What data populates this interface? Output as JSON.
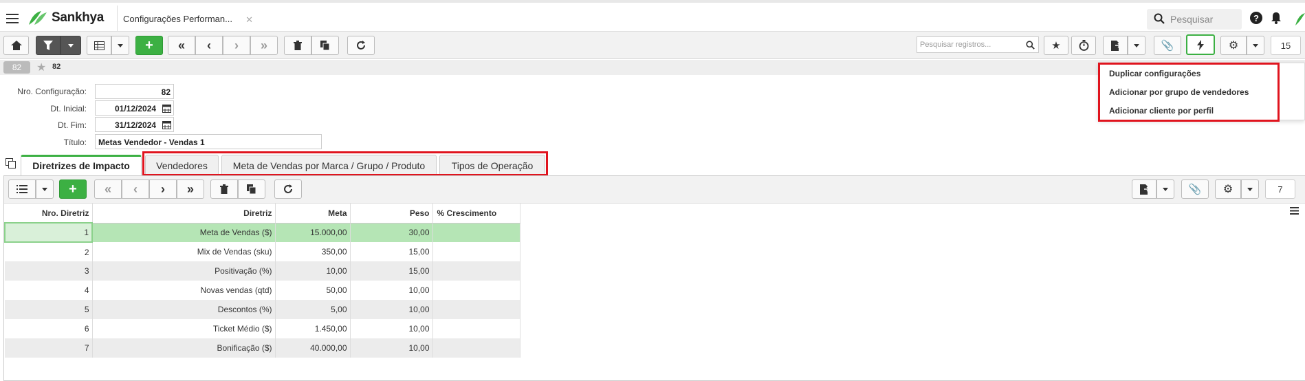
{
  "header": {
    "brand": "Sankhya",
    "page_tab": "Configurações Performan...",
    "search_placeholder": "Pesquisar"
  },
  "toolbar": {
    "search_records_placeholder": "Pesquisar registros...",
    "page_size": "15"
  },
  "record": {
    "badge": "82",
    "id": "82"
  },
  "form": {
    "fields": [
      {
        "label": "Nro. Configuração:",
        "value": "82"
      },
      {
        "label": "Dt. Inicial:",
        "value": "01/12/2024"
      },
      {
        "label": "Dt. Fim:",
        "value": "31/12/2024"
      },
      {
        "label": "Título:",
        "value": "Metas Vendedor - Vendas 1"
      }
    ]
  },
  "actions_menu": {
    "items": [
      "Duplicar configurações",
      "Adicionar por grupo de vendedores",
      "Adicionar cliente por perfil"
    ]
  },
  "tabs": [
    "Diretrizes de Impacto",
    "Vendedores",
    "Meta de Vendas por Marca / Grupo / Produto",
    "Tipos de Operação"
  ],
  "detail": {
    "page_size": "7",
    "columns": [
      "Nro. Diretriz",
      "Diretriz",
      "Meta",
      "Peso",
      "% Crescimento"
    ],
    "rows": [
      [
        "1",
        "Meta de Vendas ($)",
        "15.000,00",
        "30,00",
        ""
      ],
      [
        "2",
        "Mix de Vendas (sku)",
        "350,00",
        "15,00",
        ""
      ],
      [
        "3",
        "Positivação (%)",
        "10,00",
        "15,00",
        ""
      ],
      [
        "4",
        "Novas vendas (qtd)",
        "50,00",
        "10,00",
        ""
      ],
      [
        "5",
        "Descontos (%)",
        "5,00",
        "10,00",
        ""
      ],
      [
        "6",
        "Ticket Médio ($)",
        "1.450,00",
        "10,00",
        ""
      ],
      [
        "7",
        "Bonificação ($)",
        "40.000,00",
        "10,00",
        ""
      ]
    ]
  },
  "colors": {
    "accent_green": "#3cb043",
    "highlight_red": "#e0141e",
    "selected_row": "#b5e5b5"
  }
}
